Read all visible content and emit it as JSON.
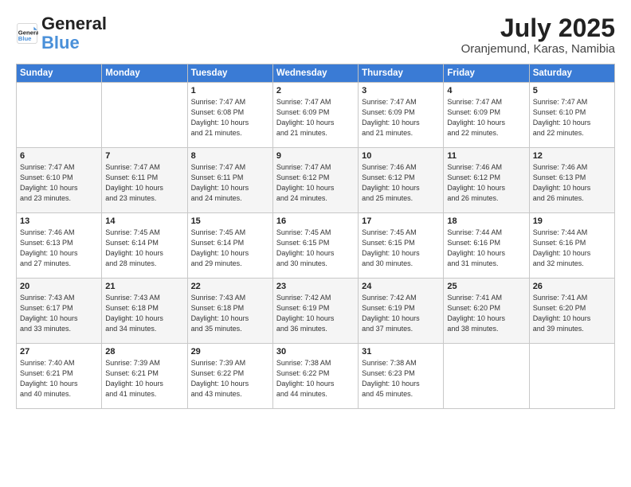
{
  "logo": {
    "line1": "General",
    "line2": "Blue"
  },
  "title": {
    "month_year": "July 2025",
    "location": "Oranjemund, Karas, Namibia"
  },
  "days_of_week": [
    "Sunday",
    "Monday",
    "Tuesday",
    "Wednesday",
    "Thursday",
    "Friday",
    "Saturday"
  ],
  "weeks": [
    [
      {
        "day": "",
        "detail": ""
      },
      {
        "day": "",
        "detail": ""
      },
      {
        "day": "1",
        "detail": "Sunrise: 7:47 AM\nSunset: 6:08 PM\nDaylight: 10 hours\nand 21 minutes."
      },
      {
        "day": "2",
        "detail": "Sunrise: 7:47 AM\nSunset: 6:09 PM\nDaylight: 10 hours\nand 21 minutes."
      },
      {
        "day": "3",
        "detail": "Sunrise: 7:47 AM\nSunset: 6:09 PM\nDaylight: 10 hours\nand 21 minutes."
      },
      {
        "day": "4",
        "detail": "Sunrise: 7:47 AM\nSunset: 6:09 PM\nDaylight: 10 hours\nand 22 minutes."
      },
      {
        "day": "5",
        "detail": "Sunrise: 7:47 AM\nSunset: 6:10 PM\nDaylight: 10 hours\nand 22 minutes."
      }
    ],
    [
      {
        "day": "6",
        "detail": "Sunrise: 7:47 AM\nSunset: 6:10 PM\nDaylight: 10 hours\nand 23 minutes."
      },
      {
        "day": "7",
        "detail": "Sunrise: 7:47 AM\nSunset: 6:11 PM\nDaylight: 10 hours\nand 23 minutes."
      },
      {
        "day": "8",
        "detail": "Sunrise: 7:47 AM\nSunset: 6:11 PM\nDaylight: 10 hours\nand 24 minutes."
      },
      {
        "day": "9",
        "detail": "Sunrise: 7:47 AM\nSunset: 6:12 PM\nDaylight: 10 hours\nand 24 minutes."
      },
      {
        "day": "10",
        "detail": "Sunrise: 7:46 AM\nSunset: 6:12 PM\nDaylight: 10 hours\nand 25 minutes."
      },
      {
        "day": "11",
        "detail": "Sunrise: 7:46 AM\nSunset: 6:12 PM\nDaylight: 10 hours\nand 26 minutes."
      },
      {
        "day": "12",
        "detail": "Sunrise: 7:46 AM\nSunset: 6:13 PM\nDaylight: 10 hours\nand 26 minutes."
      }
    ],
    [
      {
        "day": "13",
        "detail": "Sunrise: 7:46 AM\nSunset: 6:13 PM\nDaylight: 10 hours\nand 27 minutes."
      },
      {
        "day": "14",
        "detail": "Sunrise: 7:45 AM\nSunset: 6:14 PM\nDaylight: 10 hours\nand 28 minutes."
      },
      {
        "day": "15",
        "detail": "Sunrise: 7:45 AM\nSunset: 6:14 PM\nDaylight: 10 hours\nand 29 minutes."
      },
      {
        "day": "16",
        "detail": "Sunrise: 7:45 AM\nSunset: 6:15 PM\nDaylight: 10 hours\nand 30 minutes."
      },
      {
        "day": "17",
        "detail": "Sunrise: 7:45 AM\nSunset: 6:15 PM\nDaylight: 10 hours\nand 30 minutes."
      },
      {
        "day": "18",
        "detail": "Sunrise: 7:44 AM\nSunset: 6:16 PM\nDaylight: 10 hours\nand 31 minutes."
      },
      {
        "day": "19",
        "detail": "Sunrise: 7:44 AM\nSunset: 6:16 PM\nDaylight: 10 hours\nand 32 minutes."
      }
    ],
    [
      {
        "day": "20",
        "detail": "Sunrise: 7:43 AM\nSunset: 6:17 PM\nDaylight: 10 hours\nand 33 minutes."
      },
      {
        "day": "21",
        "detail": "Sunrise: 7:43 AM\nSunset: 6:18 PM\nDaylight: 10 hours\nand 34 minutes."
      },
      {
        "day": "22",
        "detail": "Sunrise: 7:43 AM\nSunset: 6:18 PM\nDaylight: 10 hours\nand 35 minutes."
      },
      {
        "day": "23",
        "detail": "Sunrise: 7:42 AM\nSunset: 6:19 PM\nDaylight: 10 hours\nand 36 minutes."
      },
      {
        "day": "24",
        "detail": "Sunrise: 7:42 AM\nSunset: 6:19 PM\nDaylight: 10 hours\nand 37 minutes."
      },
      {
        "day": "25",
        "detail": "Sunrise: 7:41 AM\nSunset: 6:20 PM\nDaylight: 10 hours\nand 38 minutes."
      },
      {
        "day": "26",
        "detail": "Sunrise: 7:41 AM\nSunset: 6:20 PM\nDaylight: 10 hours\nand 39 minutes."
      }
    ],
    [
      {
        "day": "27",
        "detail": "Sunrise: 7:40 AM\nSunset: 6:21 PM\nDaylight: 10 hours\nand 40 minutes."
      },
      {
        "day": "28",
        "detail": "Sunrise: 7:39 AM\nSunset: 6:21 PM\nDaylight: 10 hours\nand 41 minutes."
      },
      {
        "day": "29",
        "detail": "Sunrise: 7:39 AM\nSunset: 6:22 PM\nDaylight: 10 hours\nand 43 minutes."
      },
      {
        "day": "30",
        "detail": "Sunrise: 7:38 AM\nSunset: 6:22 PM\nDaylight: 10 hours\nand 44 minutes."
      },
      {
        "day": "31",
        "detail": "Sunrise: 7:38 AM\nSunset: 6:23 PM\nDaylight: 10 hours\nand 45 minutes."
      },
      {
        "day": "",
        "detail": ""
      },
      {
        "day": "",
        "detail": ""
      }
    ]
  ]
}
